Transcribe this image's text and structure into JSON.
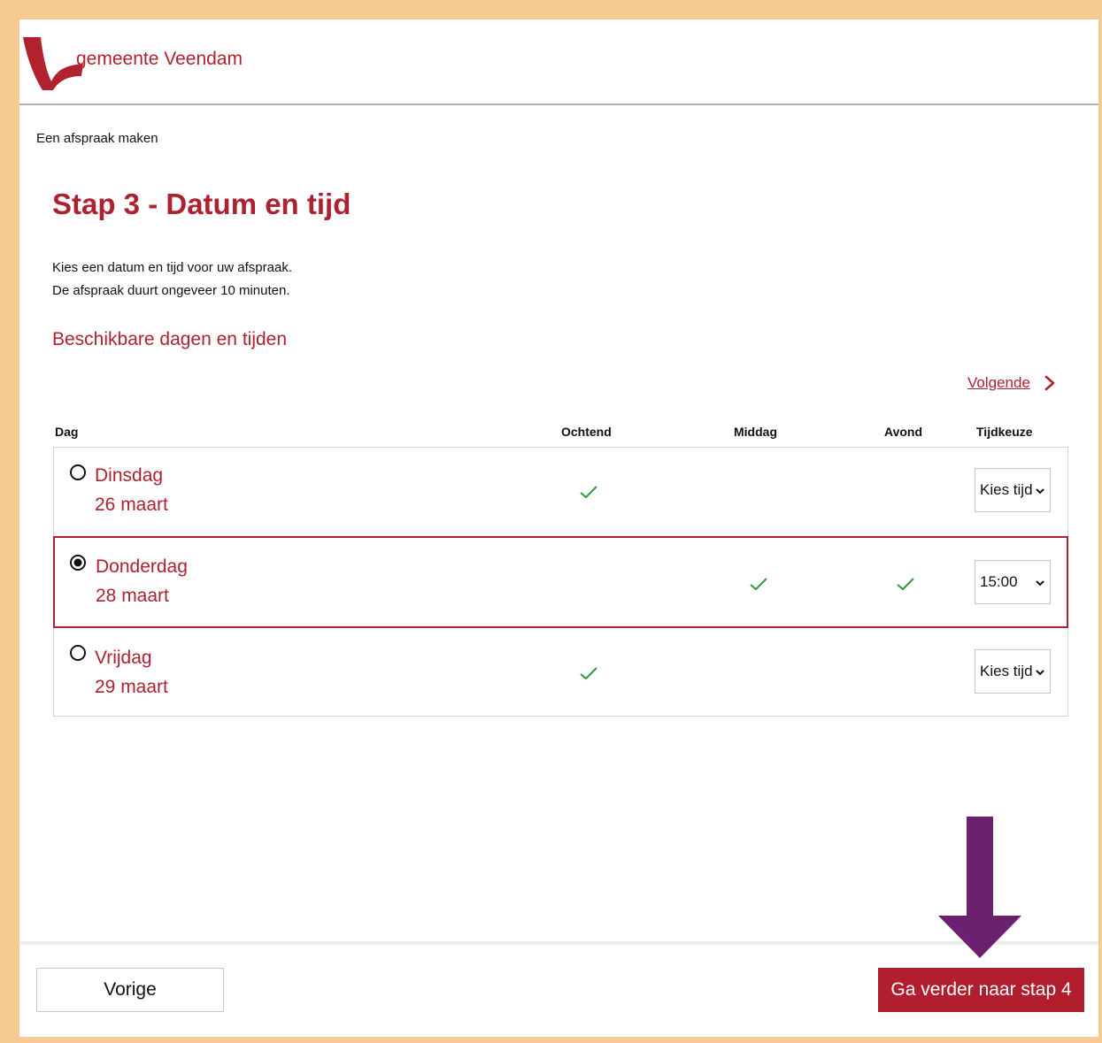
{
  "header": {
    "brand": "gemeente Veendam",
    "logo_icon": "veendam-logo-icon"
  },
  "breadcrumb": "Een afspraak maken",
  "page": {
    "title": "Stap 3 - Datum en tijd",
    "intro_line1": "Kies een datum en tijd voor uw afspraak.",
    "intro_line2": "De afspraak duurt ongeveer 10 minuten.",
    "subtitle": "Beschikbare dagen en tijden"
  },
  "pager": {
    "next_label": "Volgende",
    "next_icon": "chevron-right-icon"
  },
  "table": {
    "columns": [
      "Dag",
      "Ochtend",
      "Middag",
      "Avond",
      "Tijdkeuze"
    ],
    "rows": [
      {
        "day": "Dinsdag",
        "date": "26 maart",
        "ochtend": true,
        "middag": false,
        "avond": false,
        "selected": false,
        "time": "Kies tijd"
      },
      {
        "day": "Donderdag",
        "date": "28 maart",
        "ochtend": false,
        "middag": true,
        "avond": true,
        "selected": true,
        "time": "15:00"
      },
      {
        "day": "Vrijdag",
        "date": "29 maart",
        "ochtend": true,
        "middag": false,
        "avond": false,
        "selected": false,
        "time": "Kies tijd"
      }
    ]
  },
  "footer": {
    "prev_label": "Vorige",
    "next_label": "Ga verder naar stap 4"
  },
  "annotation": {
    "icon": "arrow-down-icon",
    "color": "#6b2170"
  },
  "colors": {
    "accent": "#ac2231",
    "check": "#2b9a3b",
    "frame": "#f7c993"
  }
}
